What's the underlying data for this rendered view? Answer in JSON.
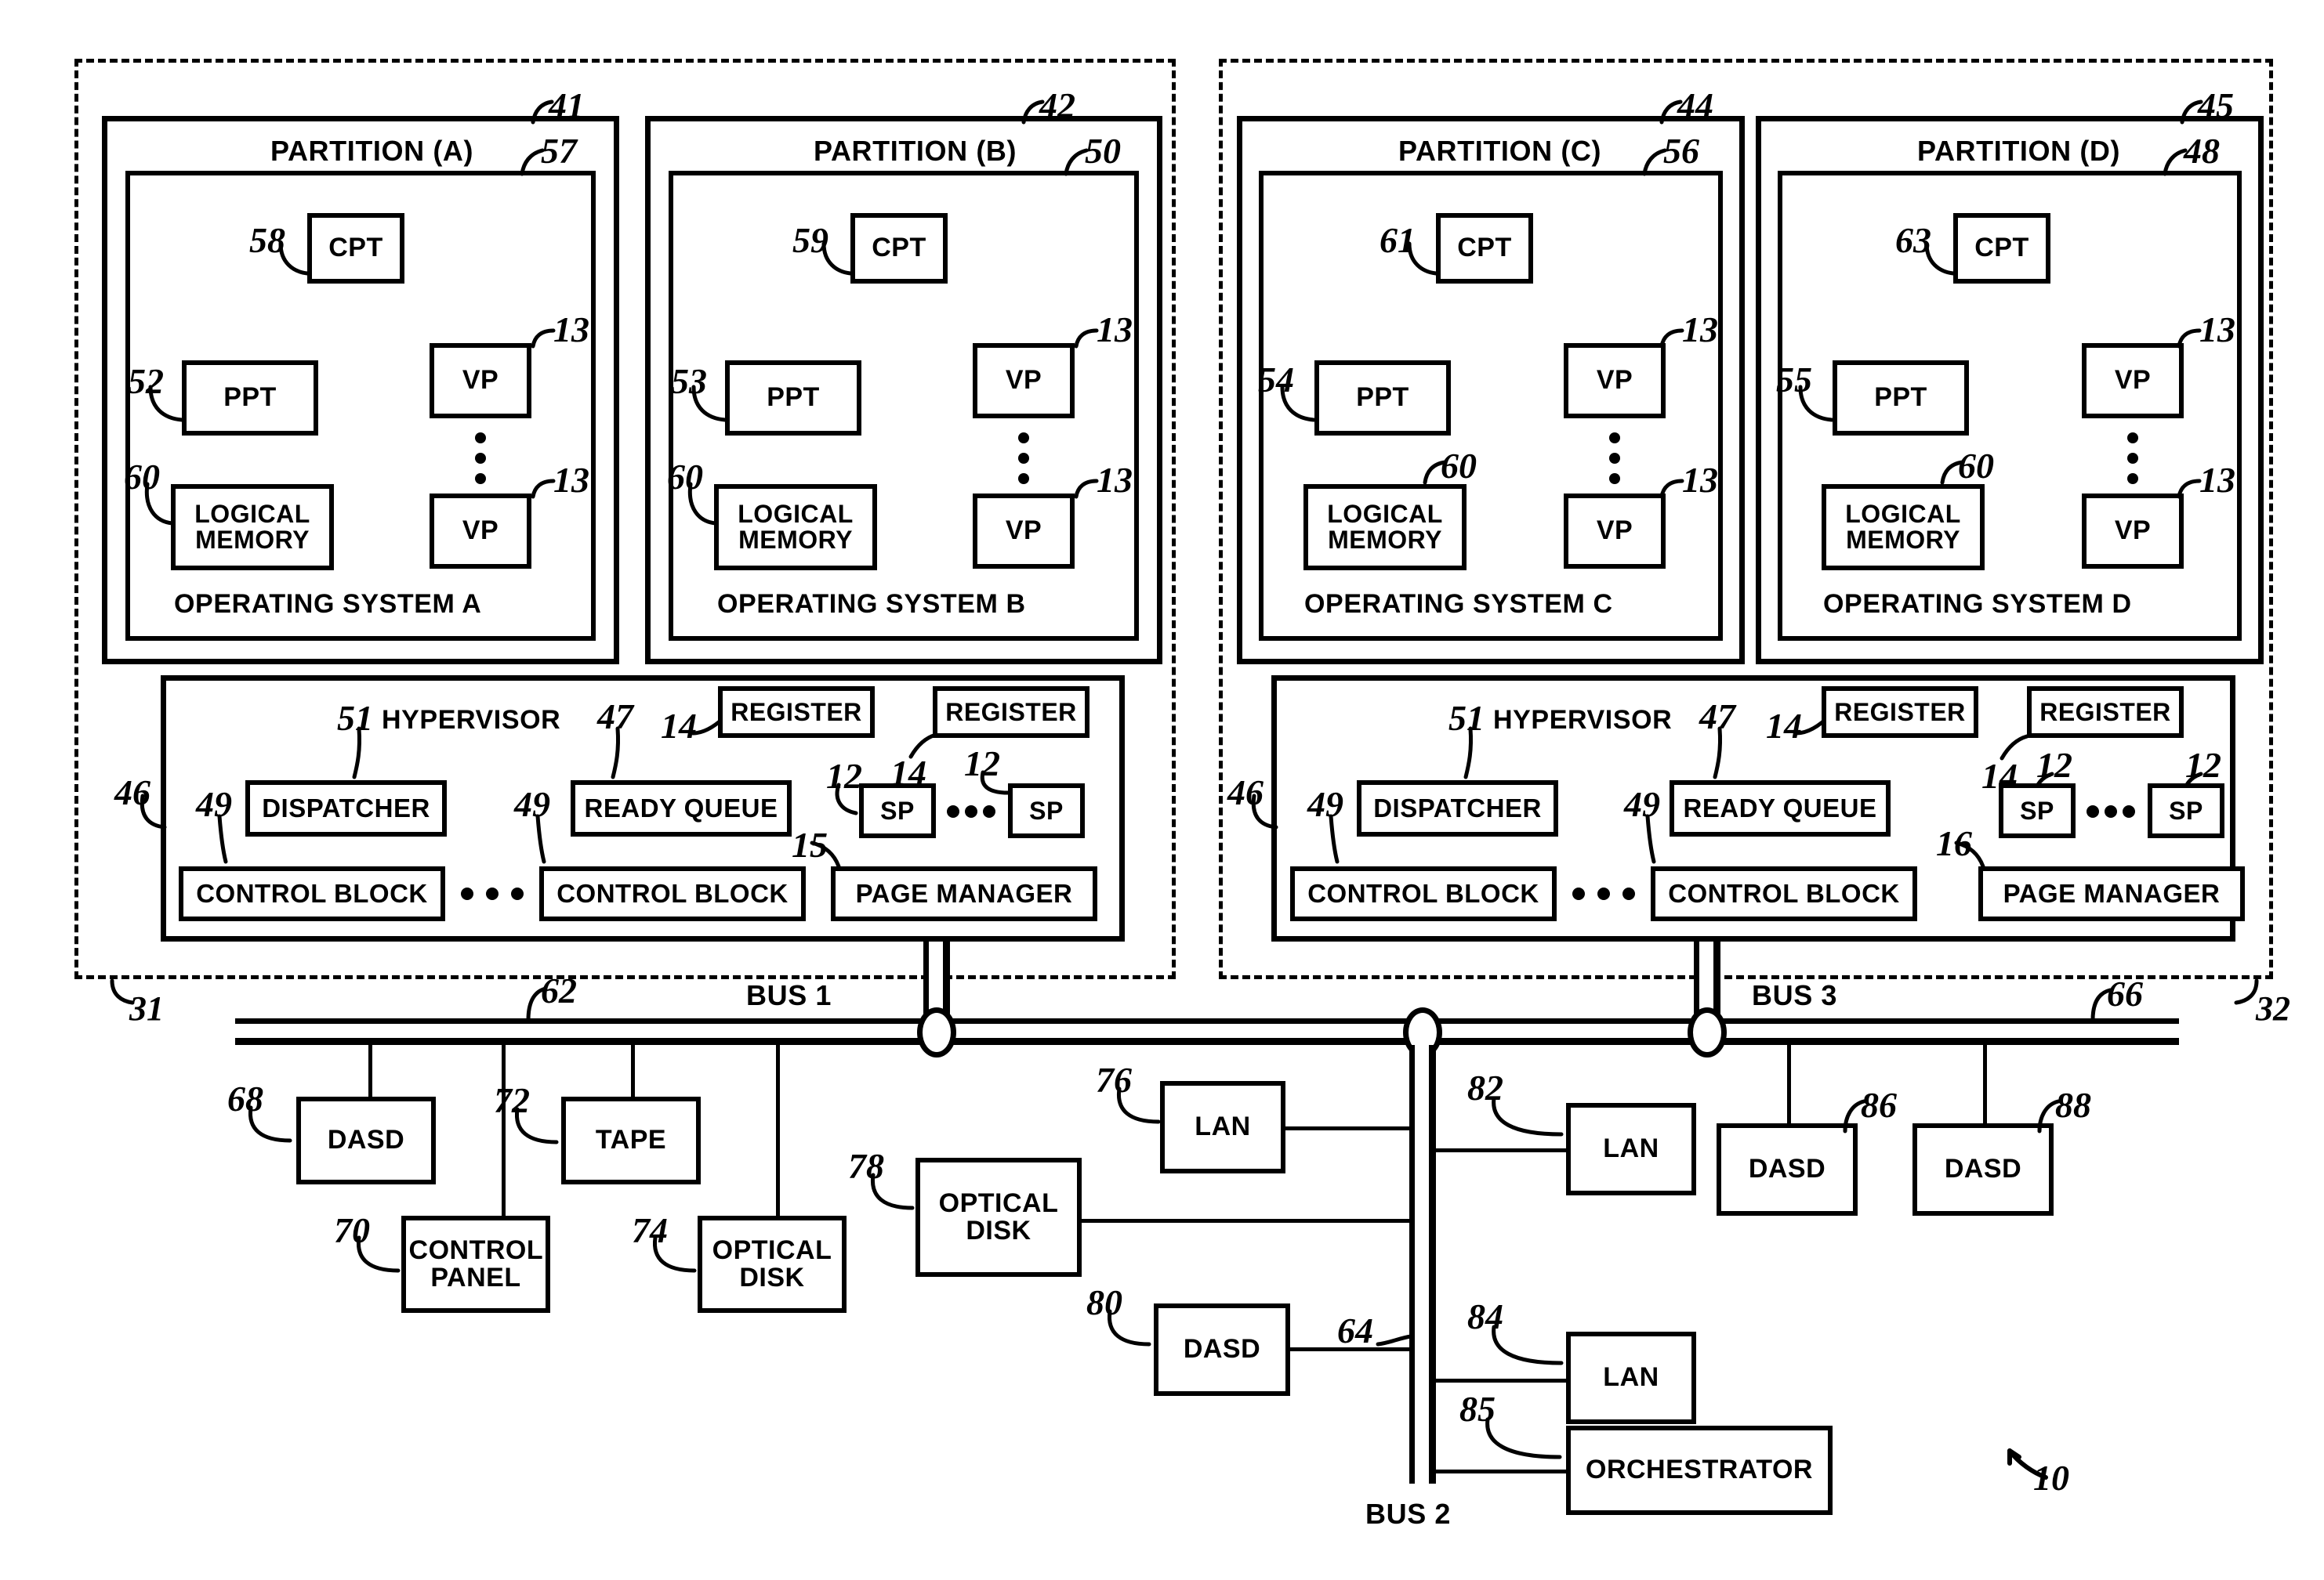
{
  "figure": {
    "system_ref": "10",
    "node_left_ref": "31",
    "node_right_ref": "32"
  },
  "nodes": [
    {
      "id": "left",
      "ref": "31",
      "partitions": [
        {
          "title": "PARTITION (A)",
          "partition_ref": "41",
          "os_ref": "57",
          "os_label": "OPERATING SYSTEM A",
          "cpt_label": "CPT",
          "cpt_ref": "58",
          "ppt_label": "PPT",
          "ppt_ref": "52",
          "memory_label": "LOGICAL MEMORY",
          "memory_ref": "60",
          "vp_label": "VP",
          "vp_ref_top": "13",
          "vp_ref_bottom": "13"
        },
        {
          "title": "PARTITION (B)",
          "partition_ref": "42",
          "os_ref": "50",
          "os_label": "OPERATING SYSTEM B",
          "cpt_label": "CPT",
          "cpt_ref": "59",
          "ppt_label": "PPT",
          "ppt_ref": "53",
          "memory_label": "LOGICAL MEMORY",
          "memory_ref": "60",
          "vp_label": "VP",
          "vp_ref_top": "13",
          "vp_ref_bottom": "13"
        }
      ],
      "hypervisor": {
        "title": "HYPERVISOR",
        "ref": "46",
        "dispatcher_label": "DISPATCHER",
        "dispatcher_ref": "51",
        "ready_queue_label": "READY QUEUE",
        "ready_queue_ref": "47",
        "register_label": "REGISTER",
        "register_ref_1": "14",
        "register_ref_2": "14",
        "control_block_label": "CONTROL BLOCK",
        "control_block_ref_1": "49",
        "control_block_ref_2": "49",
        "page_manager_label": "PAGE MANAGER",
        "page_manager_ref": "15",
        "sp_label": "SP",
        "sp_ref_1": "12",
        "sp_ref_2": "12"
      }
    },
    {
      "id": "right",
      "ref": "32",
      "partitions": [
        {
          "title": "PARTITION (C)",
          "partition_ref": "44",
          "os_ref": "56",
          "os_label": "OPERATING SYSTEM C",
          "cpt_label": "CPT",
          "cpt_ref": "61",
          "ppt_label": "PPT",
          "ppt_ref": "54",
          "memory_label": "LOGICAL MEMORY",
          "memory_ref": "60",
          "vp_label": "VP",
          "vp_ref_top": "13",
          "vp_ref_bottom": "13"
        },
        {
          "title": "PARTITION (D)",
          "partition_ref": "45",
          "os_ref": "48",
          "os_label": "OPERATING SYSTEM D",
          "cpt_label": "CPT",
          "cpt_ref": "63",
          "ppt_label": "PPT",
          "ppt_ref": "55",
          "memory_label": "LOGICAL MEMORY",
          "memory_ref": "60",
          "vp_label": "VP",
          "vp_ref_top": "13",
          "vp_ref_bottom": "13"
        }
      ],
      "hypervisor": {
        "title": "HYPERVISOR",
        "ref": "46",
        "dispatcher_label": "DISPATCHER",
        "dispatcher_ref": "51",
        "ready_queue_label": "READY QUEUE",
        "ready_queue_ref": "47",
        "register_label": "REGISTER",
        "register_ref_1": "14",
        "register_ref_2": "14",
        "control_block_label": "CONTROL BLOCK",
        "control_block_ref_1": "49",
        "control_block_ref_2": "49",
        "page_manager_label": "PAGE MANAGER",
        "page_manager_ref": "16",
        "sp_label": "SP",
        "sp_ref_1": "12",
        "sp_ref_2": "12"
      }
    }
  ],
  "buses": [
    {
      "label": "BUS 1",
      "ref": "62"
    },
    {
      "label": "BUS 2",
      "ref": "64"
    },
    {
      "label": "BUS 3",
      "ref": "66"
    }
  ],
  "devices": [
    {
      "label": "DASD",
      "ref": "68",
      "bus": "BUS 1"
    },
    {
      "label": "CONTROL PANEL",
      "ref": "70",
      "bus": "BUS 1"
    },
    {
      "label": "TAPE",
      "ref": "72",
      "bus": "BUS 1"
    },
    {
      "label": "OPTICAL DISK",
      "ref": "74",
      "bus": "BUS 1"
    },
    {
      "label": "LAN",
      "ref": "76",
      "bus": "BUS 2"
    },
    {
      "label": "OPTICAL DISK",
      "ref": "78",
      "bus": "BUS 2"
    },
    {
      "label": "DASD",
      "ref": "80",
      "bus": "BUS 2"
    },
    {
      "label": "LAN",
      "ref": "82",
      "bus": "BUS 2"
    },
    {
      "label": "LAN",
      "ref": "84",
      "bus": "BUS 2"
    },
    {
      "label": "ORCHESTRATOR",
      "ref": "85",
      "bus": "BUS 2"
    },
    {
      "label": "DASD",
      "ref": "86",
      "bus": "BUS 3"
    },
    {
      "label": "DASD",
      "ref": "88",
      "bus": "BUS 3"
    }
  ]
}
